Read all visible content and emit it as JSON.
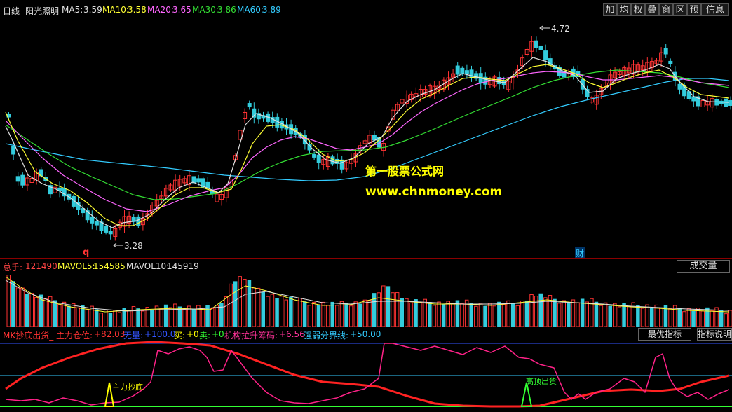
{
  "header": {
    "period": "日线",
    "stock_name": "阳光照明",
    "ma": [
      {
        "label": "MA5:",
        "value": "3.59",
        "color": "#e0e0e0"
      },
      {
        "label": "MA10:",
        "value": "3.58",
        "color": "#ffff33"
      },
      {
        "label": "MA20:",
        "value": "3.65",
        "color": "#ff66ff"
      },
      {
        "label": "MA30:",
        "value": "3.86",
        "color": "#33dd33"
      },
      {
        "label": "MA60:",
        "value": "3.89",
        "color": "#33ccff"
      }
    ]
  },
  "toolbar": {
    "buttons": [
      "加",
      "均",
      "权",
      "叠",
      "窗",
      "区",
      "预",
      "信息"
    ]
  },
  "price_chart": {
    "high_label": "4.72",
    "low_label": "3.28",
    "marker_q": "q",
    "marker_cai": "财",
    "watermark_title": "第一股票公式网",
    "watermark_url": "www.chnmoney.com"
  },
  "volume_panel": {
    "total_label": "总手:",
    "total_value": "121490",
    "mavol5_label": "MAVOL5:",
    "mavol5_value": "154585",
    "mavol10_label": "MAVOL10:",
    "mavol10_value": "145919",
    "button": "成交量"
  },
  "indicator_panel": {
    "title": "MK抄底出货_ 主力仓位:",
    "title_value": "+82.03",
    "items": [
      {
        "label": "无量:",
        "value": "+100.0",
        "color": "#3355ff"
      },
      {
        "label": "买:",
        "value": "+0",
        "color": "#ffff00"
      },
      {
        "label": "卖:",
        "value": "+0",
        "color": "#33ff33"
      },
      {
        "label": "机构拉升筹码:",
        "value": "+6.56",
        "color": "#ff3399"
      },
      {
        "label": "强弱分界线:",
        "value": "+50.00",
        "color": "#33ccff"
      }
    ],
    "buy_signal": "主力抄底",
    "sell_signal": "高顶出货",
    "btn_best": "最优指标",
    "btn_help": "指标说明"
  },
  "colors": {
    "up": "#ff3333",
    "down": "#33ccdd",
    "separator": "#8a0000",
    "ma5": "#e0e0e0",
    "ma10": "#ffff33",
    "ma20": "#ff66ff",
    "ma30": "#33dd33",
    "ma60": "#33ccff"
  },
  "chart_data": {
    "type": "line",
    "series": [
      {
        "name": "MA5",
        "last": 3.59
      },
      {
        "name": "MA10",
        "last": 3.58
      },
      {
        "name": "MA20",
        "last": 3.65
      },
      {
        "name": "MA30",
        "last": 3.86
      },
      {
        "name": "MA60",
        "last": 3.89
      }
    ],
    "annotations": [
      "4.72",
      "3.28"
    ]
  }
}
